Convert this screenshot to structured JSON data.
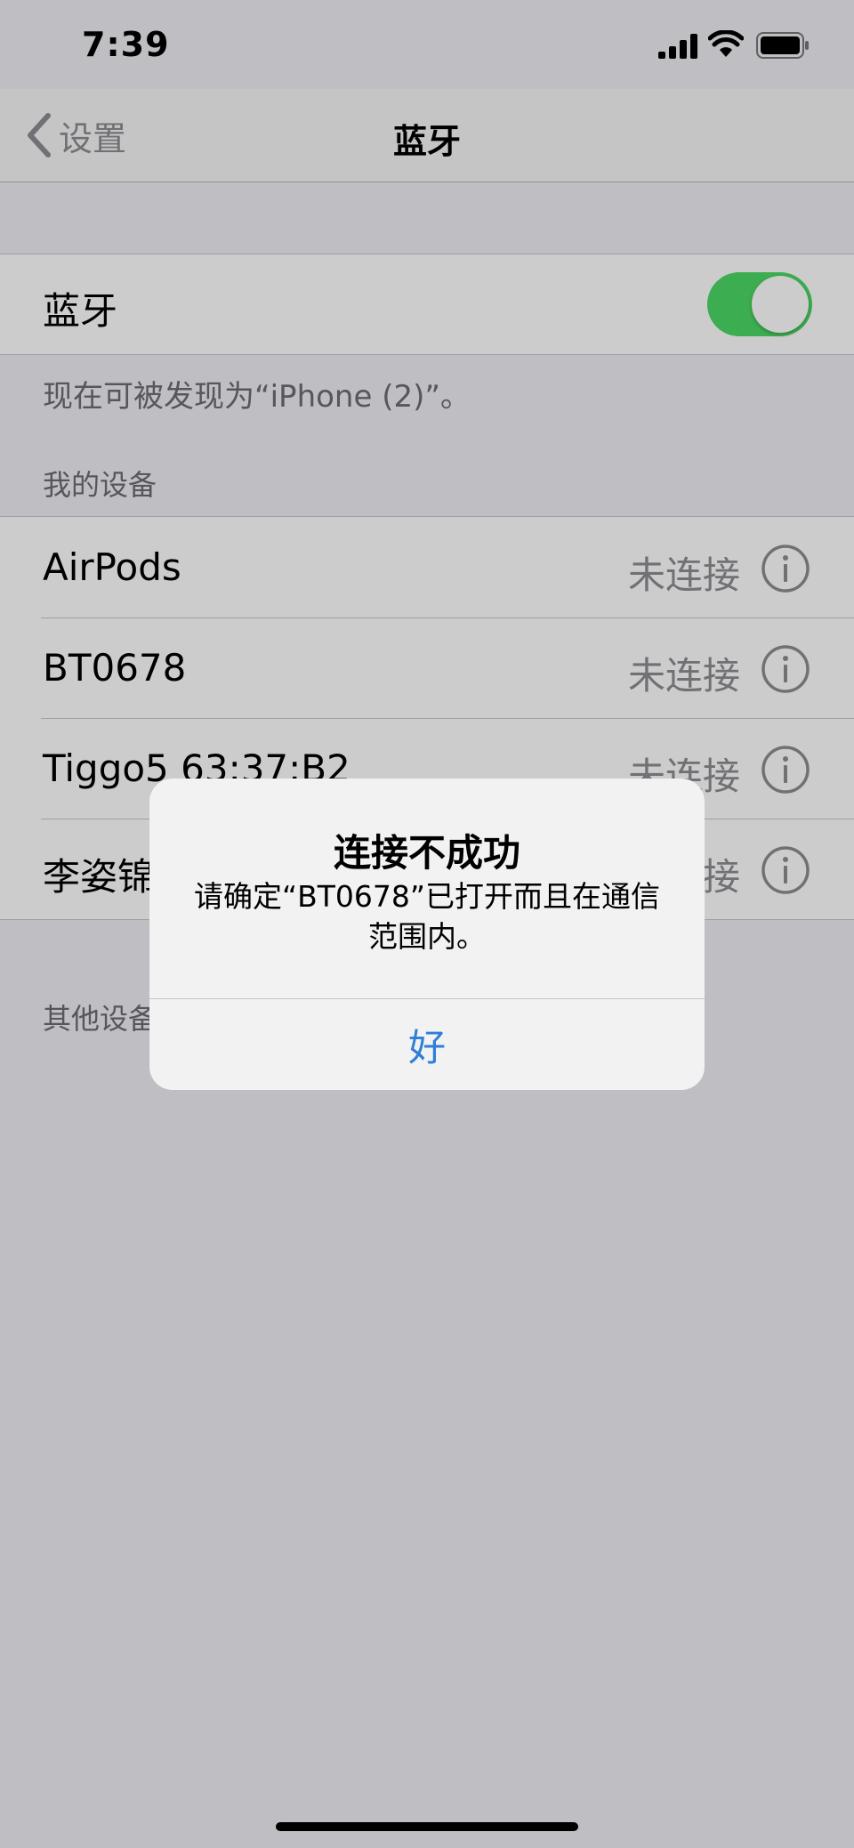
{
  "status_bar": {
    "time": "7:39"
  },
  "nav": {
    "back_label": "设置",
    "title": "蓝牙"
  },
  "bluetooth": {
    "label": "蓝牙",
    "enabled": true
  },
  "discoverable_note": "现在可被发现为“iPhone (2)”。",
  "my_devices": {
    "header": "我的设备",
    "items": [
      {
        "name": "AirPods",
        "status": "未连接"
      },
      {
        "name": "BT0678",
        "status": "未连接"
      },
      {
        "name": "Tiggo5 63:37:B2",
        "status": "未连接"
      },
      {
        "name": "李姿锦",
        "status": "未连接"
      }
    ]
  },
  "other_devices": {
    "header": "其他设备"
  },
  "alert": {
    "title": "连接不成功",
    "message": "请确定“BT0678”已打开而且在通信范围内。",
    "ok_label": "好"
  },
  "colors": {
    "toggle_on": "#4cd964",
    "alert_button": "#2f7ed8"
  }
}
